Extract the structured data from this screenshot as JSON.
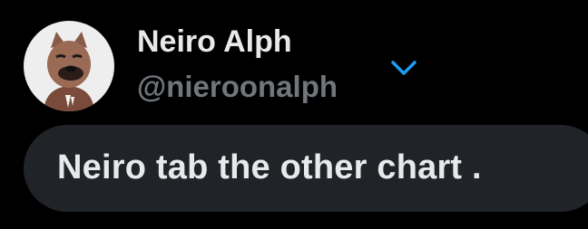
{
  "profile": {
    "display_name": "Neiro Alph",
    "handle": "@nieroonalph",
    "avatar_icon": "cartoon-dog-avatar"
  },
  "menu": {
    "icon": "chevron-down-icon",
    "accent_color": "#1d9bf0"
  },
  "post": {
    "text": "Neiro tab the other chart ."
  },
  "colors": {
    "background": "#000000",
    "bubble": "#202327",
    "primary_text": "#e7e9ea",
    "secondary_text": "#71767b"
  }
}
